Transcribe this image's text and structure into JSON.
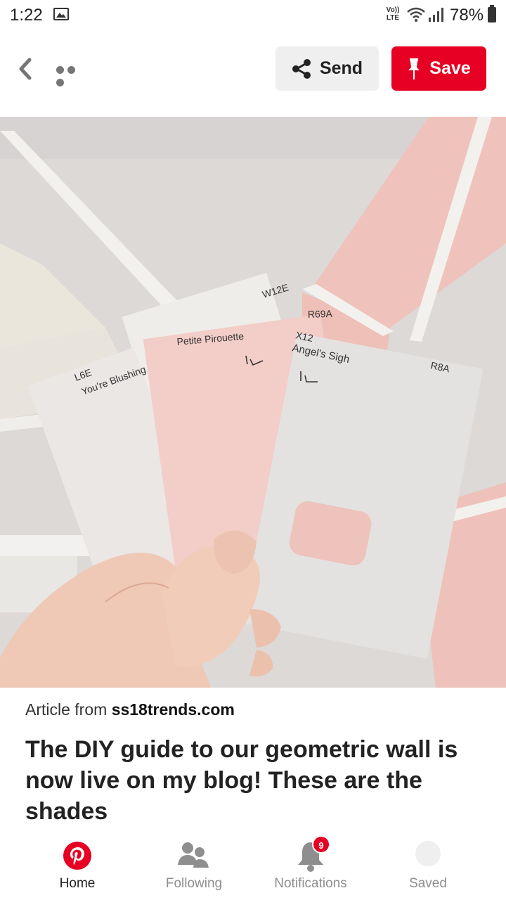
{
  "status_bar": {
    "time": "1:22",
    "network": "VoLTE",
    "battery": "78%"
  },
  "header": {
    "send_label": "Send",
    "save_label": "Save"
  },
  "pin": {
    "swatches": [
      {
        "code": "L6E",
        "name": "You're Blushing"
      },
      {
        "code": "W12E",
        "name": ""
      },
      {
        "code": "R69A",
        "name": "Petite Pirouette",
        "note": "1L"
      },
      {
        "code": "X12",
        "name": "Angel's Sigh",
        "note": "1L"
      },
      {
        "code": "R8A",
        "name": ""
      }
    ]
  },
  "article": {
    "source_prefix": "Article from ",
    "source_domain": "ss18trends.com",
    "title": "The DIY guide to our geometric wall is now live on my blog! These are the shades"
  },
  "bottom_nav": {
    "items": [
      {
        "label": "Home",
        "icon": "pinterest-logo-icon",
        "active": true
      },
      {
        "label": "Following",
        "icon": "people-icon",
        "active": false
      },
      {
        "label": "Notifications",
        "icon": "bell-icon",
        "active": false,
        "badge": "9"
      },
      {
        "label": "Saved",
        "icon": "avatar-icon",
        "active": false
      }
    ]
  },
  "colors": {
    "brand": "#e60023",
    "wall_pink": "#efc3bb",
    "wall_grey": "#d8d5d4"
  }
}
